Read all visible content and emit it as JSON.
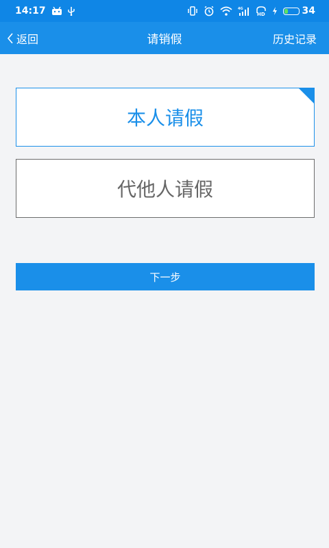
{
  "status_bar": {
    "time": "14:17",
    "battery_level": "34",
    "battery_percent": 34,
    "battery_color": "#5fe35f"
  },
  "nav": {
    "back_label": "返回",
    "title": "请销假",
    "history_label": "历史记录"
  },
  "options": {
    "self_label": "本人请假",
    "other_label": "代他人请假"
  },
  "next_label": "下一步",
  "colors": {
    "accent": "#1a8fe9",
    "status_bar": "#0f86e6",
    "background": "#f3f4f6"
  },
  "icons": [
    "android-icon",
    "usb-icon",
    "vibrate-icon",
    "alarm-icon",
    "wifi-icon",
    "signal-4g-icon",
    "signal-hd-icon",
    "charging-icon",
    "battery-icon",
    "chevron-left-icon"
  ]
}
